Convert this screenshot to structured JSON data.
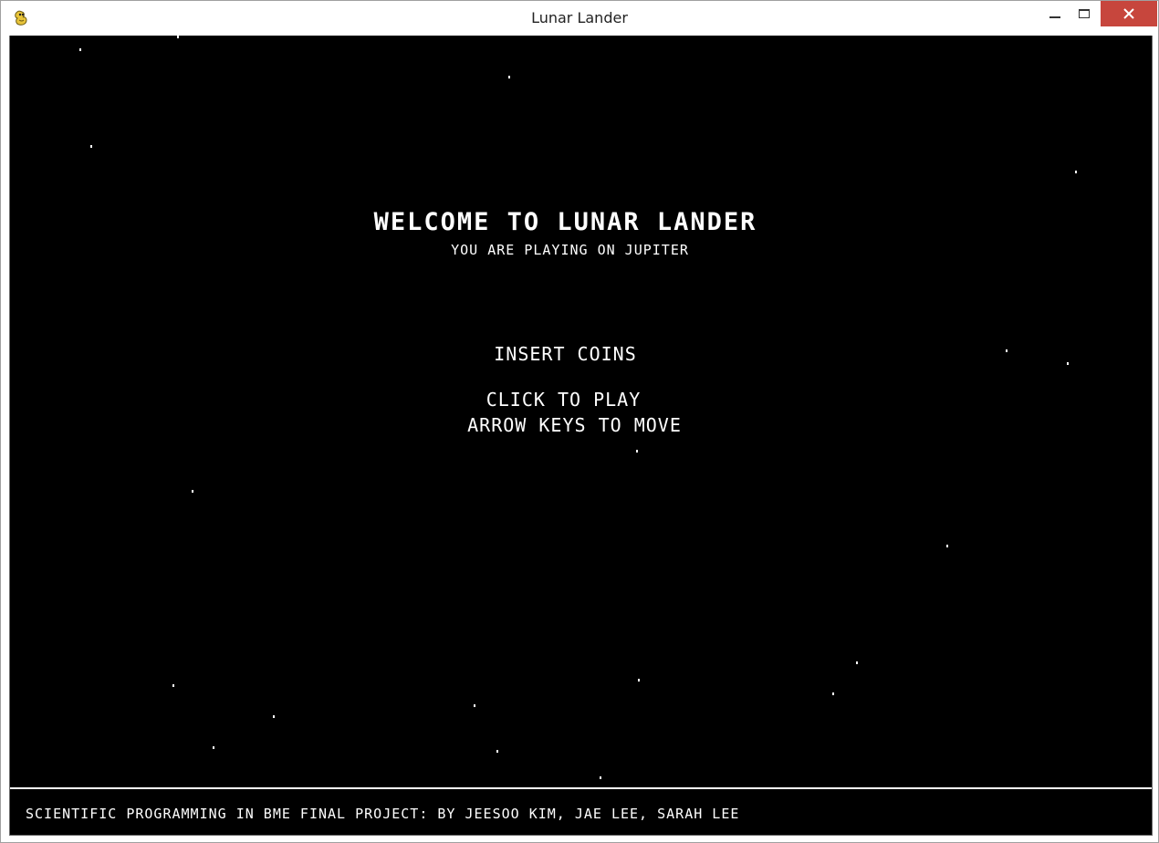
{
  "window": {
    "title": "Lunar Lander",
    "icon": "pygame-snake-icon",
    "close_color": "#c7463d"
  },
  "game": {
    "background_color": "#000000",
    "welcome_title": "WELCOME TO LUNAR LANDER",
    "planet_line": "YOU ARE PLAYING ON JUPITER",
    "insert_coins": "INSERT COINS",
    "click_to_play": "CLICK TO PLAY",
    "arrow_keys": "ARROW KEYS TO MOVE",
    "credits": "SCIENTIFIC PROGRAMMING IN BME FINAL PROJECT: BY JEESOO KIM, JAE LEE, SARAH LEE"
  }
}
